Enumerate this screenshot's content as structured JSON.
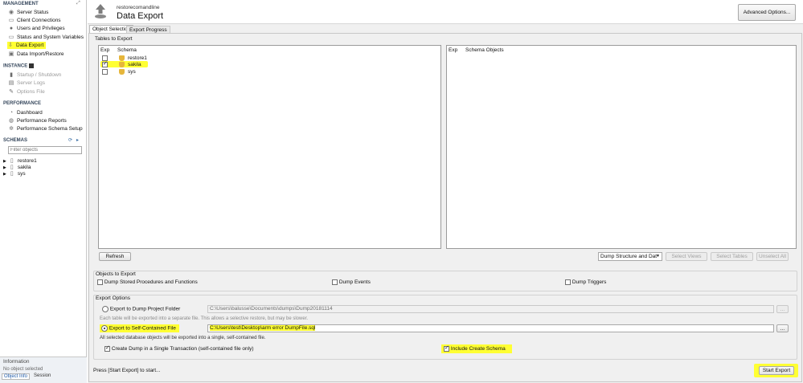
{
  "sidebar": {
    "management_title": "MANAGEMENT",
    "management_items": [
      "Server Status",
      "Client Connections",
      "Users and Privileges",
      "Status and System Variables",
      "Data Export",
      "Data Import/Restore"
    ],
    "instance_title": "INSTANCE",
    "instance_items": [
      "Startup / Shutdown",
      "Server Logs",
      "Options File"
    ],
    "performance_title": "PERFORMANCE",
    "performance_items": [
      "Dashboard",
      "Performance Reports",
      "Performance Schema Setup"
    ],
    "schemas_title": "SCHEMAS",
    "filter_placeholder": "Filter objects",
    "schemas": [
      "restore1",
      "sakila",
      "sys"
    ],
    "information_title": "Information",
    "information_text": "No object selected",
    "bottom_tabs": [
      "Object Info",
      "Session"
    ]
  },
  "header": {
    "subtitle": "restorecomandline",
    "title": "Data Export",
    "advanced_button": "Advanced Options..."
  },
  "tabs": [
    "Object Selection",
    "Export Progress"
  ],
  "tables_to_export": {
    "label": "Tables to Export",
    "left_columns": [
      "Exp",
      "Schema"
    ],
    "right_columns": [
      "Exp",
      "Schema Objects"
    ],
    "rows": [
      {
        "name": "restore1",
        "checked": false
      },
      {
        "name": "sakila",
        "checked": true
      },
      {
        "name": "sys",
        "checked": false
      }
    ],
    "refresh": "Refresh",
    "dump_select": "Dump Structure and Dat",
    "select_views": "Select Views",
    "select_tables": "Select Tables",
    "unselect_all": "Unselect All"
  },
  "objects_to_export": {
    "label": "Objects to Export",
    "dump_procs": "Dump Stored Procedures and Functions",
    "dump_events": "Dump Events",
    "dump_triggers": "Dump Triggers"
  },
  "export_options": {
    "label": "Export Options",
    "folder_label": "Export to Dump Project Folder",
    "folder_path": "C:\\Users\\balusse\\Documents\\dumps\\Dump20181114",
    "folder_note": "Each table will be exported into a separate file. This allows a selective restore, but may be slower.",
    "file_label": "Export to Self-Contained File",
    "file_path": "C:\\Users\\test\\Desktop\\arm error DumpFile.sql",
    "file_note": "All selected database objects will be exported into a single, self-contained file.",
    "single_transaction": "Create Dump in a Single Transaction (self-contained file only)",
    "include_schema": "Include Create Schema",
    "browse": "..."
  },
  "footer": {
    "status": "Press [Start Export] to start...",
    "start_export": "Start Export"
  }
}
